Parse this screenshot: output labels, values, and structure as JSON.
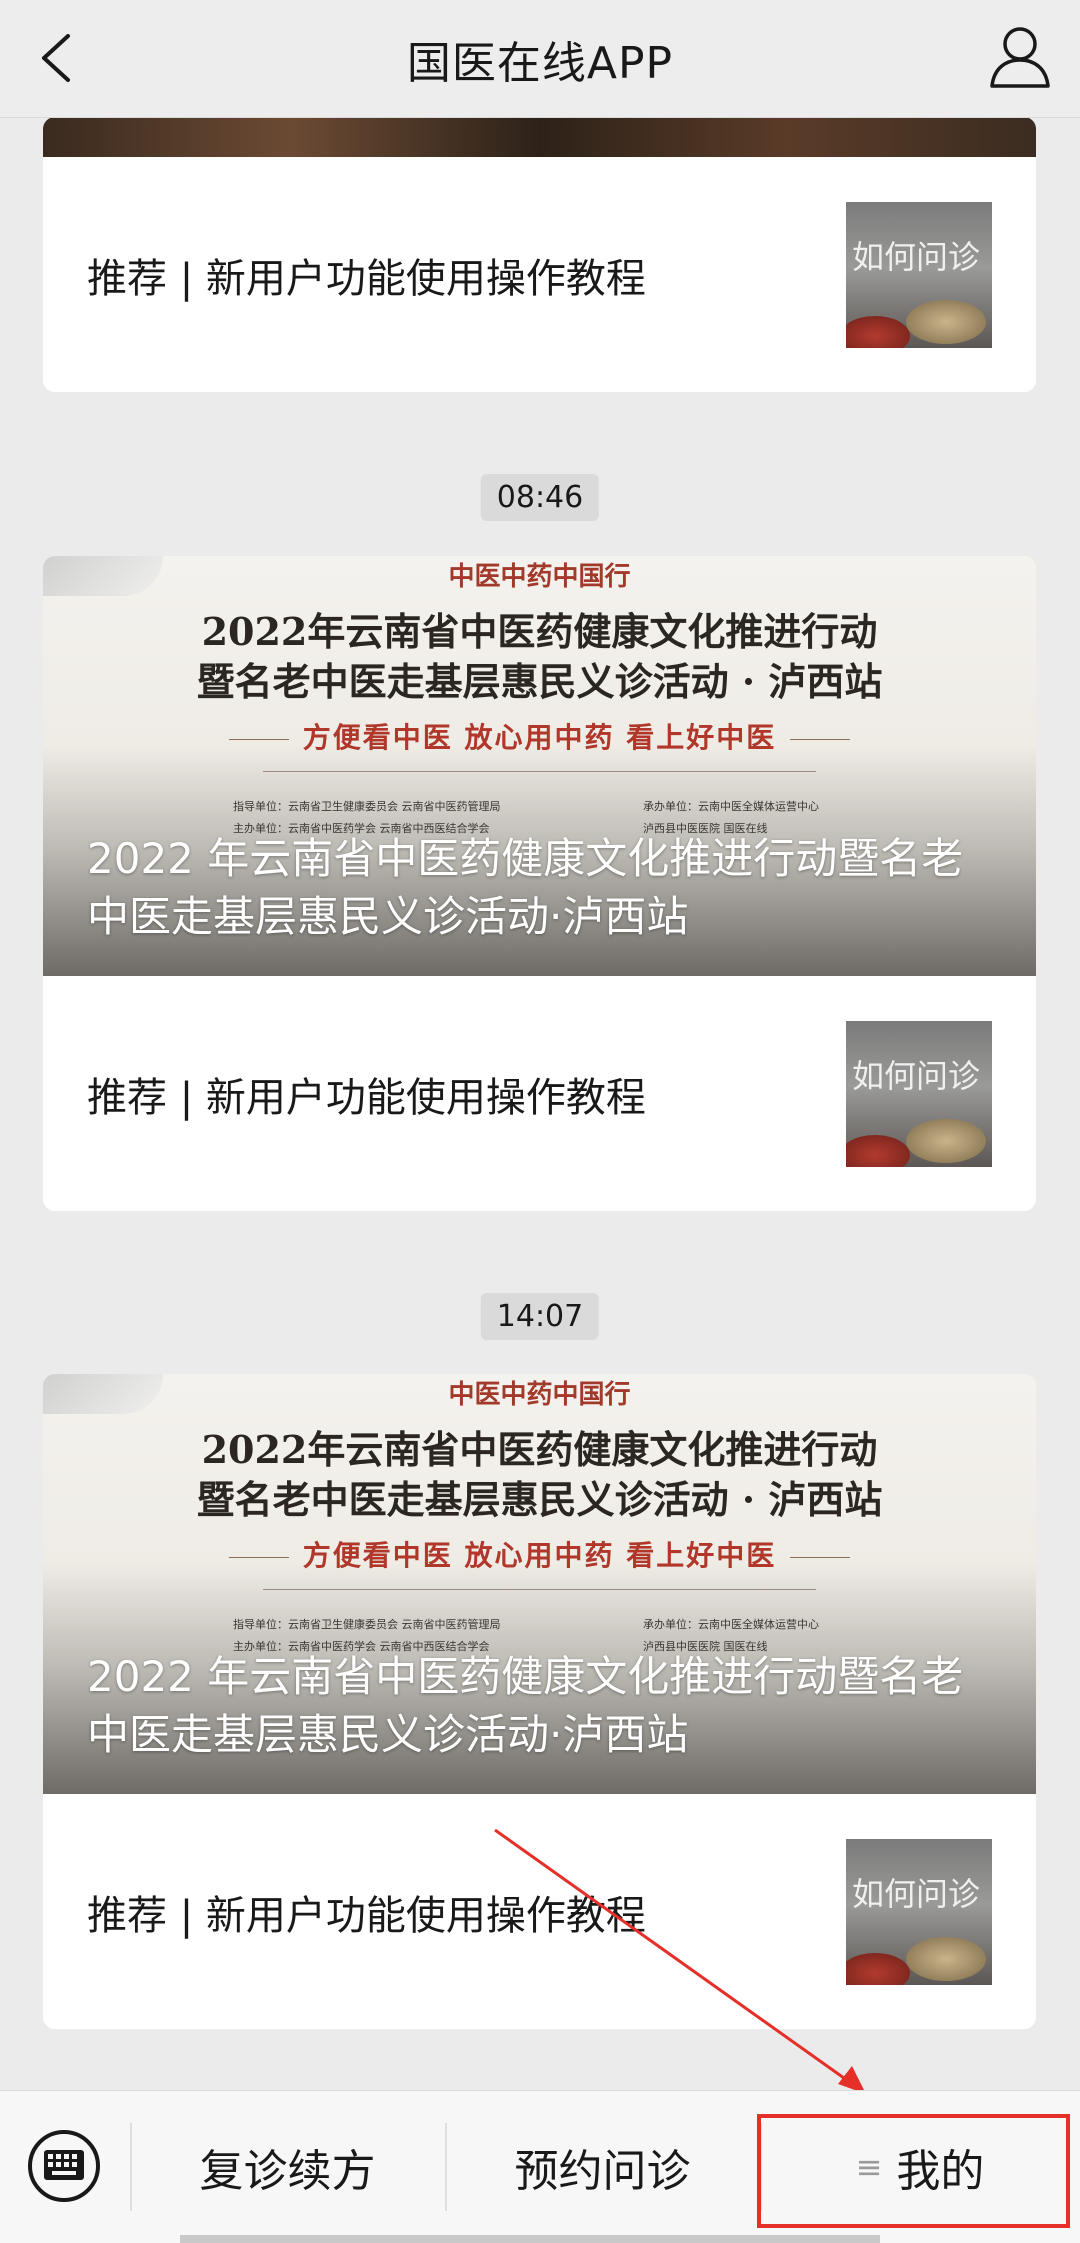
{
  "header": {
    "title": "国医在线APP"
  },
  "feed": {
    "first_card_item": "推荐 | 新用户功能使用操作教程",
    "groups": [
      {
        "time": "08:46",
        "cover": {
          "line1": "中医中药中国行",
          "line2": "2022年云南省中医药健康文化推进行动",
          "line3": "暨名老中医走基层惠民义诊活动 · 泸西站",
          "slogan": "方便看中医  放心用中药  看上好中医",
          "org_left": [
            "指导单位：云南省卫生健康委员会    云南省中医药管理局",
            "主办单位：云南省中医药学会    云南省中西医结合学会"
          ],
          "org_right": [
            "承办单位：云南中医全媒体运营中心",
            "泸西县中医医院    国医在线"
          ],
          "overlay_title": "2022 年云南省中医药健康文化推进行动暨名老中医走基层惠民义诊活动·泸西站"
        },
        "item": "推荐 | 新用户功能使用操作教程",
        "thumb_text": "如何问诊"
      },
      {
        "time": "14:07",
        "cover": {
          "line1": "中医中药中国行",
          "line2": "2022年云南省中医药健康文化推进行动",
          "line3": "暨名老中医走基层惠民义诊活动 · 泸西站",
          "slogan": "方便看中医  放心用中药  看上好中医",
          "org_left": [
            "指导单位：云南省卫生健康委员会    云南省中医药管理局",
            "主办单位：云南省中医药学会    云南省中西医结合学会"
          ],
          "org_right": [
            "承办单位：云南中医全媒体运营中心",
            "泸西县中医医院    国医在线"
          ],
          "overlay_title": "2022 年云南省中医药健康文化推进行动暨名老中医走基层惠民义诊活动·泸西站"
        },
        "item": "推荐 | 新用户功能使用操作教程",
        "thumb_text": "如何问诊"
      }
    ],
    "thumb_text": "如何问诊"
  },
  "bottom_bar": {
    "tabs": [
      {
        "label": "复诊续方"
      },
      {
        "label": "预约问诊"
      },
      {
        "label": "我的"
      }
    ],
    "menu_glyph": "≡"
  },
  "colors": {
    "highlight": "#e5302a",
    "background": "#ebebeb"
  }
}
